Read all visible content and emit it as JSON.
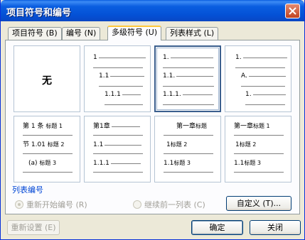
{
  "window": {
    "title": "项目符号和编号"
  },
  "tabs": [
    {
      "label": "项目符号 (B)"
    },
    {
      "label": "编号 (N)"
    },
    {
      "label": "多级符号 (U)"
    },
    {
      "label": "列表样式 (L)"
    }
  ],
  "none_card": {
    "label": "无"
  },
  "card2": {
    "l1": "1",
    "l2": "1.1",
    "l3": "1.1.1"
  },
  "card3": {
    "l1": "1.",
    "l2": "1.1.",
    "l3": "1.1.1."
  },
  "card4": {
    "l1": "1.",
    "l2": "A.",
    "l3": "1."
  },
  "card5": {
    "r1a": "第 1 条",
    "r1b": "标题 1",
    "r2a": "节 1.01",
    "r2b": "标题 2",
    "r3a": "(a)",
    "r3b": "标题 3"
  },
  "card6": {
    "l1": "第1章",
    "l2": "1.1",
    "l3": "1.1.1"
  },
  "card7": {
    "r1a": "第一章",
    "r1b": "标题",
    "r2a": "1",
    "r2b": "标题 2",
    "r3a": "1.1",
    "r3b": "标题 3"
  },
  "card8": {
    "r1a": "第一章",
    "r1b": "标题 1",
    "r2a": "1",
    "r2b": "标题 2",
    "r3a": "1.1",
    "r3b": "标题 3"
  },
  "list_numbering": {
    "group_label": "列表编号",
    "restart_label": "重新开始编号 (R)",
    "continue_label": "继续前一列表 (C)",
    "customize_label": "自定义 (T)..."
  },
  "footer": {
    "reset_label": "重新设置 (E)",
    "ok_label": "确定",
    "cancel_label": "关闭"
  }
}
